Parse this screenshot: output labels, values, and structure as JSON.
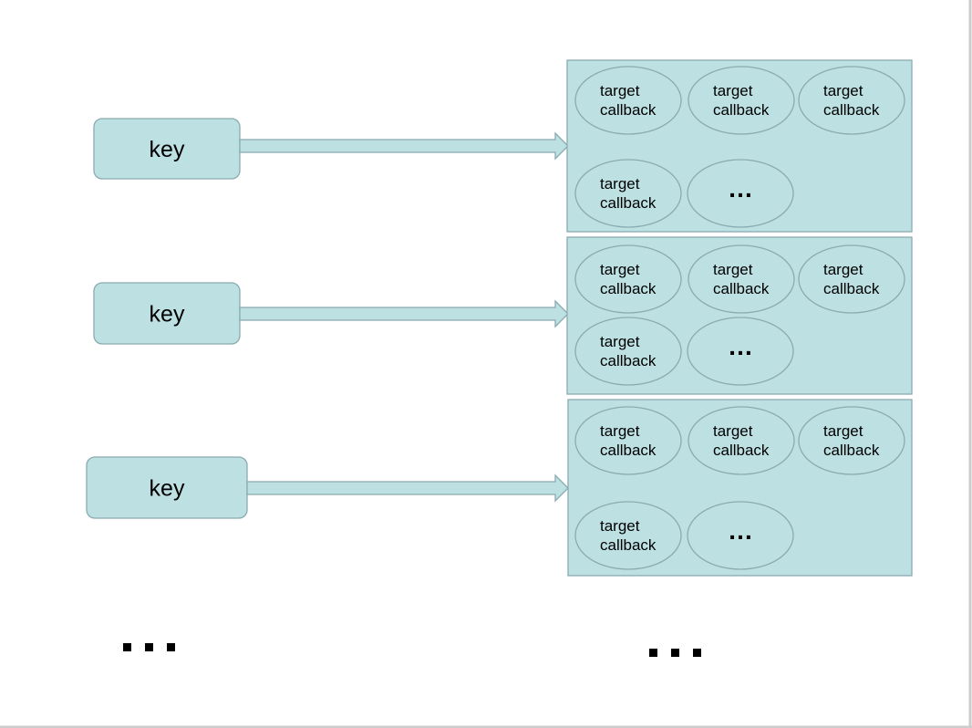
{
  "colors": {
    "fill": "#bde0e3",
    "stroke": "#8aabb0",
    "text": "#000000",
    "slide_border": "#cccccc"
  },
  "rows": [
    {
      "key": "key",
      "targets": [
        "target callback",
        "target callback",
        "target callback",
        "target callback"
      ],
      "more": "..."
    },
    {
      "key": "key",
      "targets": [
        "target callback",
        "target callback",
        "target callback",
        "target callback"
      ],
      "more": "..."
    },
    {
      "key": "key",
      "targets": [
        "target callback",
        "target callback",
        "target callback",
        "target callback"
      ],
      "more": "..."
    }
  ],
  "continuation": {
    "keys": "...",
    "lists": "..."
  }
}
